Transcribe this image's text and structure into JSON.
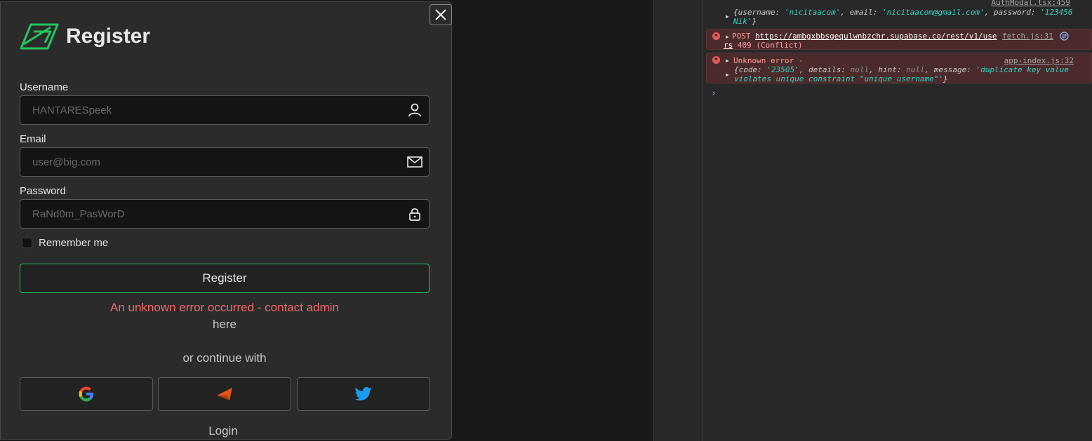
{
  "modal": {
    "title": "Register",
    "username_label": "Username",
    "username_placeholder": "HANTARESpeek",
    "email_label": "Email",
    "email_placeholder": "user@big.com",
    "password_label": "Password",
    "password_placeholder": "RaNd0m_PasWorD",
    "remember_label": "Remember me",
    "register_button": "Register",
    "error_message": "An unknown error occurred - contact admin",
    "error_link": "here",
    "or_text": "or continue with",
    "login_link": "Login",
    "accent": "#22c55e"
  },
  "console": {
    "row1": {
      "source": "AuthModal.tsx:459",
      "k1": "username",
      "v1": "'nicitaacom'",
      "k2": "email",
      "v2": "'nicitaacom@gmail.com'",
      "k3": "password",
      "v3": "'123456",
      "v3b": "Nik'"
    },
    "row2": {
      "method": "POST",
      "url": "https://ambgxbbsgequlwnbzchr.supabase.co/rest/v1/use",
      "url2": "rs",
      "status": "409 (Conflict)",
      "source": "fetch.js:31"
    },
    "row3": {
      "title": "Unknown error -",
      "source": "app-index.js:32",
      "k1": "code",
      "v1": "'23505'",
      "k2": "details",
      "v2": "null",
      "k3": "hint",
      "v3": "null",
      "k4": "message",
      "v4": "'duplicate key value",
      "v4b": "violates unique constraint \"unique_username\"'"
    },
    "prompt": "›"
  }
}
